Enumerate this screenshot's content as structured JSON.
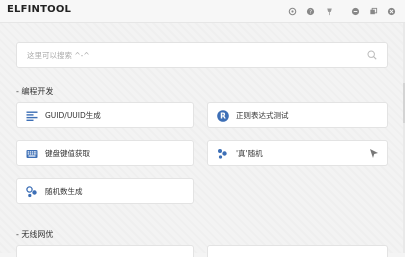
{
  "app": {
    "title": "ELFINTOOL"
  },
  "titlebar_icons": [
    "settings-icon",
    "help-icon",
    "pin-icon",
    "minimize-icon",
    "restore-icon",
    "close-icon"
  ],
  "search": {
    "placeholder": "这里可以搜索 ^-^"
  },
  "sections": [
    {
      "title": "- 编程开发",
      "items": [
        {
          "label": "GUID/UUID生成",
          "icon": "list-lines-icon"
        },
        {
          "label": "正则表达式测试",
          "icon": "regex-r-icon"
        },
        {
          "label": "键盘键值获取",
          "icon": "keyboard-icon"
        },
        {
          "label": "'真'随机",
          "icon": "dots-cluster-icon"
        },
        {
          "label": "随机数生成",
          "icon": "random-circles-icon"
        }
      ]
    },
    {
      "title": "- 无线网优",
      "items": []
    }
  ],
  "colors": {
    "accent": "#3d6fb6",
    "background": "#f3f3f3",
    "card": "#ffffff"
  }
}
